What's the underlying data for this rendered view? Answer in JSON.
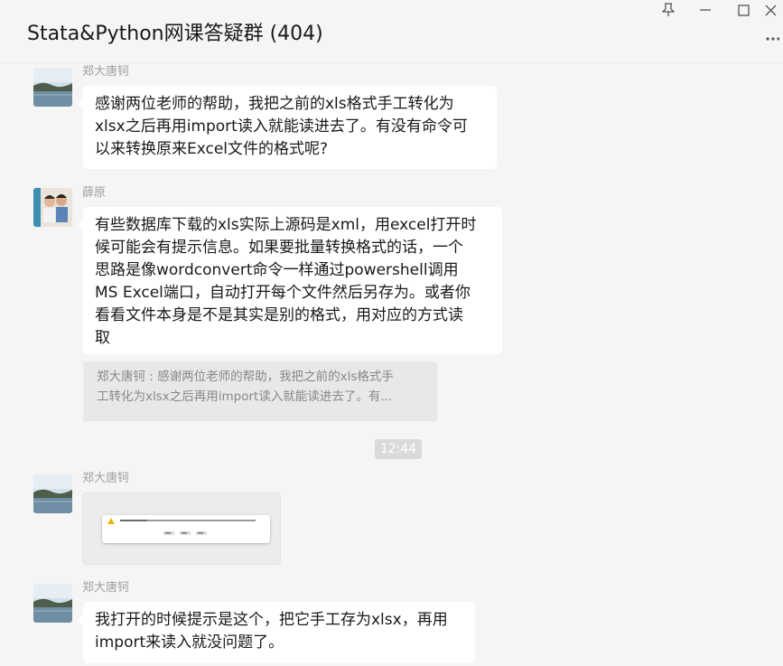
{
  "header": {
    "title": "Stata&Python网课答疑群 (404)"
  },
  "messages": [
    {
      "sender": "郑大唐钶",
      "lines": [
        "感谢两位老师的帮助，我把之前的xls格式手工转化为",
        "xlsx之后再用import读入就能读进去了。有没有命令可",
        "以来转换原来Excel文件的格式呢?"
      ]
    },
    {
      "sender": "薛原",
      "lines": [
        "有些数据库下载的xls实际上源码是xml，用excel打开时",
        "候可能会有提示信息。如果要批量转换格式的话，一个",
        "思路是像wordconvert命令一样通过powershell调用",
        "MS Excel端口，自动打开每个文件然后另存为。或者你",
        "看看文件本身是不是其实是别的格式，用对应的方式读",
        "取"
      ],
      "quote_lines": [
        "郑大唐钶 : 感谢两位老师的帮助，我把之前的xls格式手",
        "工转化为xlsx之后再用import读入就能读进去了。有..."
      ]
    },
    {
      "time": "12:44"
    },
    {
      "sender": "郑大唐钶"
    },
    {
      "sender": "郑大唐钶",
      "lines": [
        "我打开的时候提示是这个，把它手工存为xlsx，再用",
        "import来读入就没问题了。"
      ]
    }
  ],
  "icons": {
    "pin": "pin-icon",
    "minimize": "minimize-icon",
    "maximize": "maximize-icon",
    "close": "close-icon",
    "more": "more-icon"
  },
  "colors": {
    "background": "#f5f5f5",
    "bubble": "#ffffff",
    "sender": "#a0a0a0",
    "quote_bg": "#e8e8e8",
    "time_bg": "#dadada"
  }
}
